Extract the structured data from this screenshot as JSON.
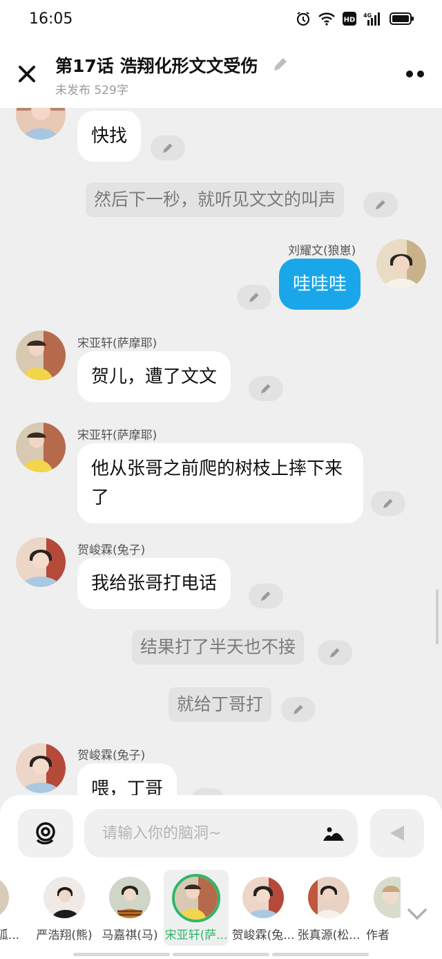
{
  "status": {
    "time": "16:05",
    "network": "4G"
  },
  "header": {
    "title": "第17话   浩翔化形文文受伤",
    "subtitle": "未发布 529字"
  },
  "chat": {
    "m1_text": "快找",
    "n1": "然后下一秒，就听见文文的叫声",
    "m2_sender": "刘耀文(狼崽)",
    "m2_text": "哇哇哇",
    "m3_sender": "宋亚轩(萨摩耶)",
    "m3_text": "贺儿，遭了文文",
    "m4_sender": "宋亚轩(萨摩耶)",
    "m4_text": "他从张哥之前爬的树枝上摔下来了",
    "m5_sender": "贺峻霖(兔子)",
    "m5_text": "我给张哥打电话",
    "n2": "结果打了半天也不接",
    "n3": "就给丁哥打",
    "m6_sender": "贺峻霖(兔子)",
    "m6_text": "喂，丁哥"
  },
  "input": {
    "placeholder": "请输入你的脑洞~"
  },
  "characters": [
    {
      "name": "(狐..."
    },
    {
      "name": "严浩翔(熊)"
    },
    {
      "name": "马嘉祺(马)"
    },
    {
      "name": "宋亚轩(萨..."
    },
    {
      "name": "贺峻霖(兔..."
    },
    {
      "name": "张真源(松..."
    },
    {
      "name": "作者"
    }
  ],
  "colors": {
    "accent_blue": "#1aa7ea",
    "selected_green": "#30b66a"
  }
}
